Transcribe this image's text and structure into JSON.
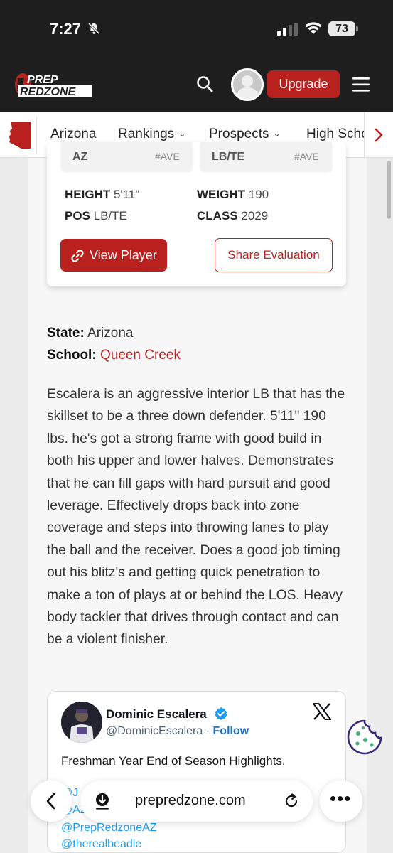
{
  "status_bar": {
    "time": "7:27",
    "battery": "73"
  },
  "header": {
    "logo_top": "PREP",
    "logo_bottom": "REDZONE",
    "upgrade_label": "Upgrade"
  },
  "nav": {
    "items": [
      {
        "label": "Arizona",
        "has_chevron": false
      },
      {
        "label": "Rankings",
        "has_chevron": true
      },
      {
        "label": "Prospects",
        "has_chevron": true
      },
      {
        "label": "High Scho",
        "has_chevron": false
      }
    ]
  },
  "player_card": {
    "rank_left": "AZ",
    "rank_left_sub": "#AVE",
    "rank_right": "LB/TE",
    "rank_right_sub": "#AVE",
    "height_label": "HEIGHT",
    "height_value": "5'11\"",
    "weight_label": "WEIGHT",
    "weight_value": "190",
    "pos_label": "POS",
    "pos_value": "LB/TE",
    "class_label": "CLASS",
    "class_value": "2029",
    "view_player_label": "View Player",
    "share_label": "Share Evaluation"
  },
  "meta": {
    "state_label": "State:",
    "state_value": "Arizona",
    "school_label": "School:",
    "school_value": "Queen Creek"
  },
  "evaluation": "Escalera is an aggressive interior LB that has the skillset to be a three down defender. 5'11\" 190 lbs. he's got a strong frame with good build in both his upper and lower halves. Demonstrates that he can fill gaps with hard pursuit and good leverage. Effectively drops back into zone coverage and steps into throwing lanes to play the ball and the receiver. Does a good job timing out his blitz's and getting quick penetration to make a ton of plays at or behind the LOS. Heavy body tackler that drives through contact and can be a violent finisher.",
  "tweet": {
    "name": "Dominic Escalera",
    "handle": "@DominicEscalera",
    "follow": "Follow",
    "separator": "·",
    "text": "Freshman Year End of Season Highlights.",
    "links": [
      "@J",
      "@AZ",
      "@PrepRedzoneAZ",
      "@therealbeadle"
    ]
  },
  "browser": {
    "url": "prepredzone.com",
    "more": "•••"
  },
  "colors": {
    "brand_red": "#b8211e",
    "header_bg": "#1e1e1e",
    "link_blue": "#1d9bf0"
  }
}
